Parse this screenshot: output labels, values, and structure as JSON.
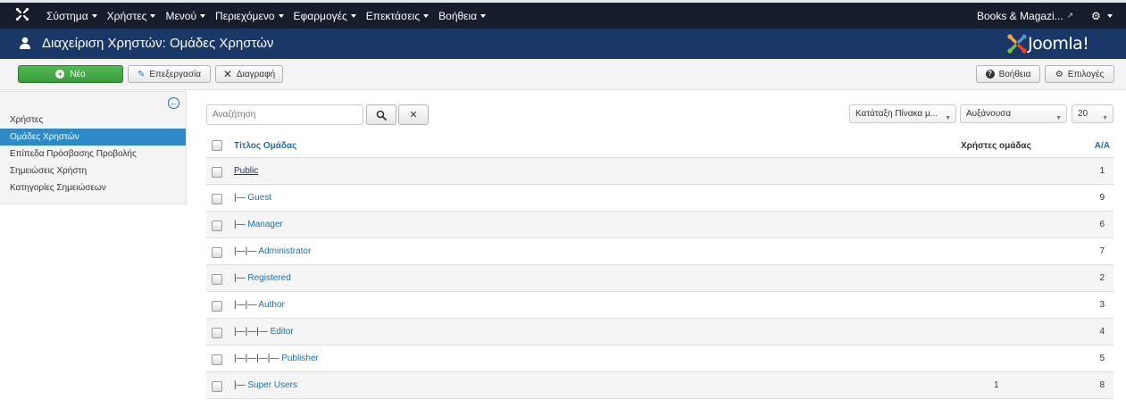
{
  "topbar": {
    "menu": [
      {
        "label": "Σύστημα"
      },
      {
        "label": "Χρήστες"
      },
      {
        "label": "Μενού"
      },
      {
        "label": "Περιεχόμενο"
      },
      {
        "label": "Εφαρμογές"
      },
      {
        "label": "Επεκτάσεις"
      },
      {
        "label": "Βοήθεια"
      }
    ],
    "site_link": "Books & Magazi...",
    "icons": {
      "logo": "joomla-icon",
      "external": "external-link-icon",
      "settings": "gear-icon"
    }
  },
  "header": {
    "title": "Διαχείριση Χρηστών: Ομάδες Χρηστών",
    "brand": "Joomla!"
  },
  "toolbar": {
    "new_label": "Νέο",
    "edit_label": "Επεξεργασία",
    "delete_label": "Διαγραφή",
    "help_label": "Βοήθεια",
    "options_label": "Επιλογές"
  },
  "sidebar": {
    "items": [
      {
        "label": "Χρήστες",
        "active": false
      },
      {
        "label": "Ομάδες Χρηστών",
        "active": true
      },
      {
        "label": "Επίπεδα Πρόσβασης Προβολής",
        "active": false
      },
      {
        "label": "Σημειώσεις Χρήστη",
        "active": false
      },
      {
        "label": "Κατηγορίες Σημειώσεων",
        "active": false
      }
    ]
  },
  "filters": {
    "search_placeholder": "Αναζήτηση",
    "ordering": "Κατάταξη Πίνακα μ...",
    "direction": "Αυξάνουσα",
    "limit": "20"
  },
  "table": {
    "columns": {
      "title": "Τίτλος Ομάδας",
      "users": "Χρήστες ομάδας",
      "id": "Α/Α"
    },
    "rows": [
      {
        "prefix": "",
        "title": "Public",
        "users": "",
        "id": "1"
      },
      {
        "prefix": "|— ",
        "title": "Guest",
        "users": "",
        "id": "9"
      },
      {
        "prefix": "|— ",
        "title": "Manager",
        "users": "",
        "id": "6"
      },
      {
        "prefix": "|—|— ",
        "title": "Administrator",
        "users": "",
        "id": "7"
      },
      {
        "prefix": "|— ",
        "title": "Registered",
        "users": "",
        "id": "2"
      },
      {
        "prefix": "|—|— ",
        "title": "Author",
        "users": "",
        "id": "3"
      },
      {
        "prefix": "|—|—|— ",
        "title": "Editor",
        "users": "",
        "id": "4"
      },
      {
        "prefix": "|—|—|—|— ",
        "title": "Publisher",
        "users": "",
        "id": "5"
      },
      {
        "prefix": "|— ",
        "title": "Super Users",
        "users": "1",
        "id": "8"
      }
    ]
  },
  "colors": {
    "topbar": "#171d2b",
    "header": "#1a3867",
    "active": "#2d8ac7",
    "new_button": "#46a546",
    "link": "#1a6fb0"
  }
}
